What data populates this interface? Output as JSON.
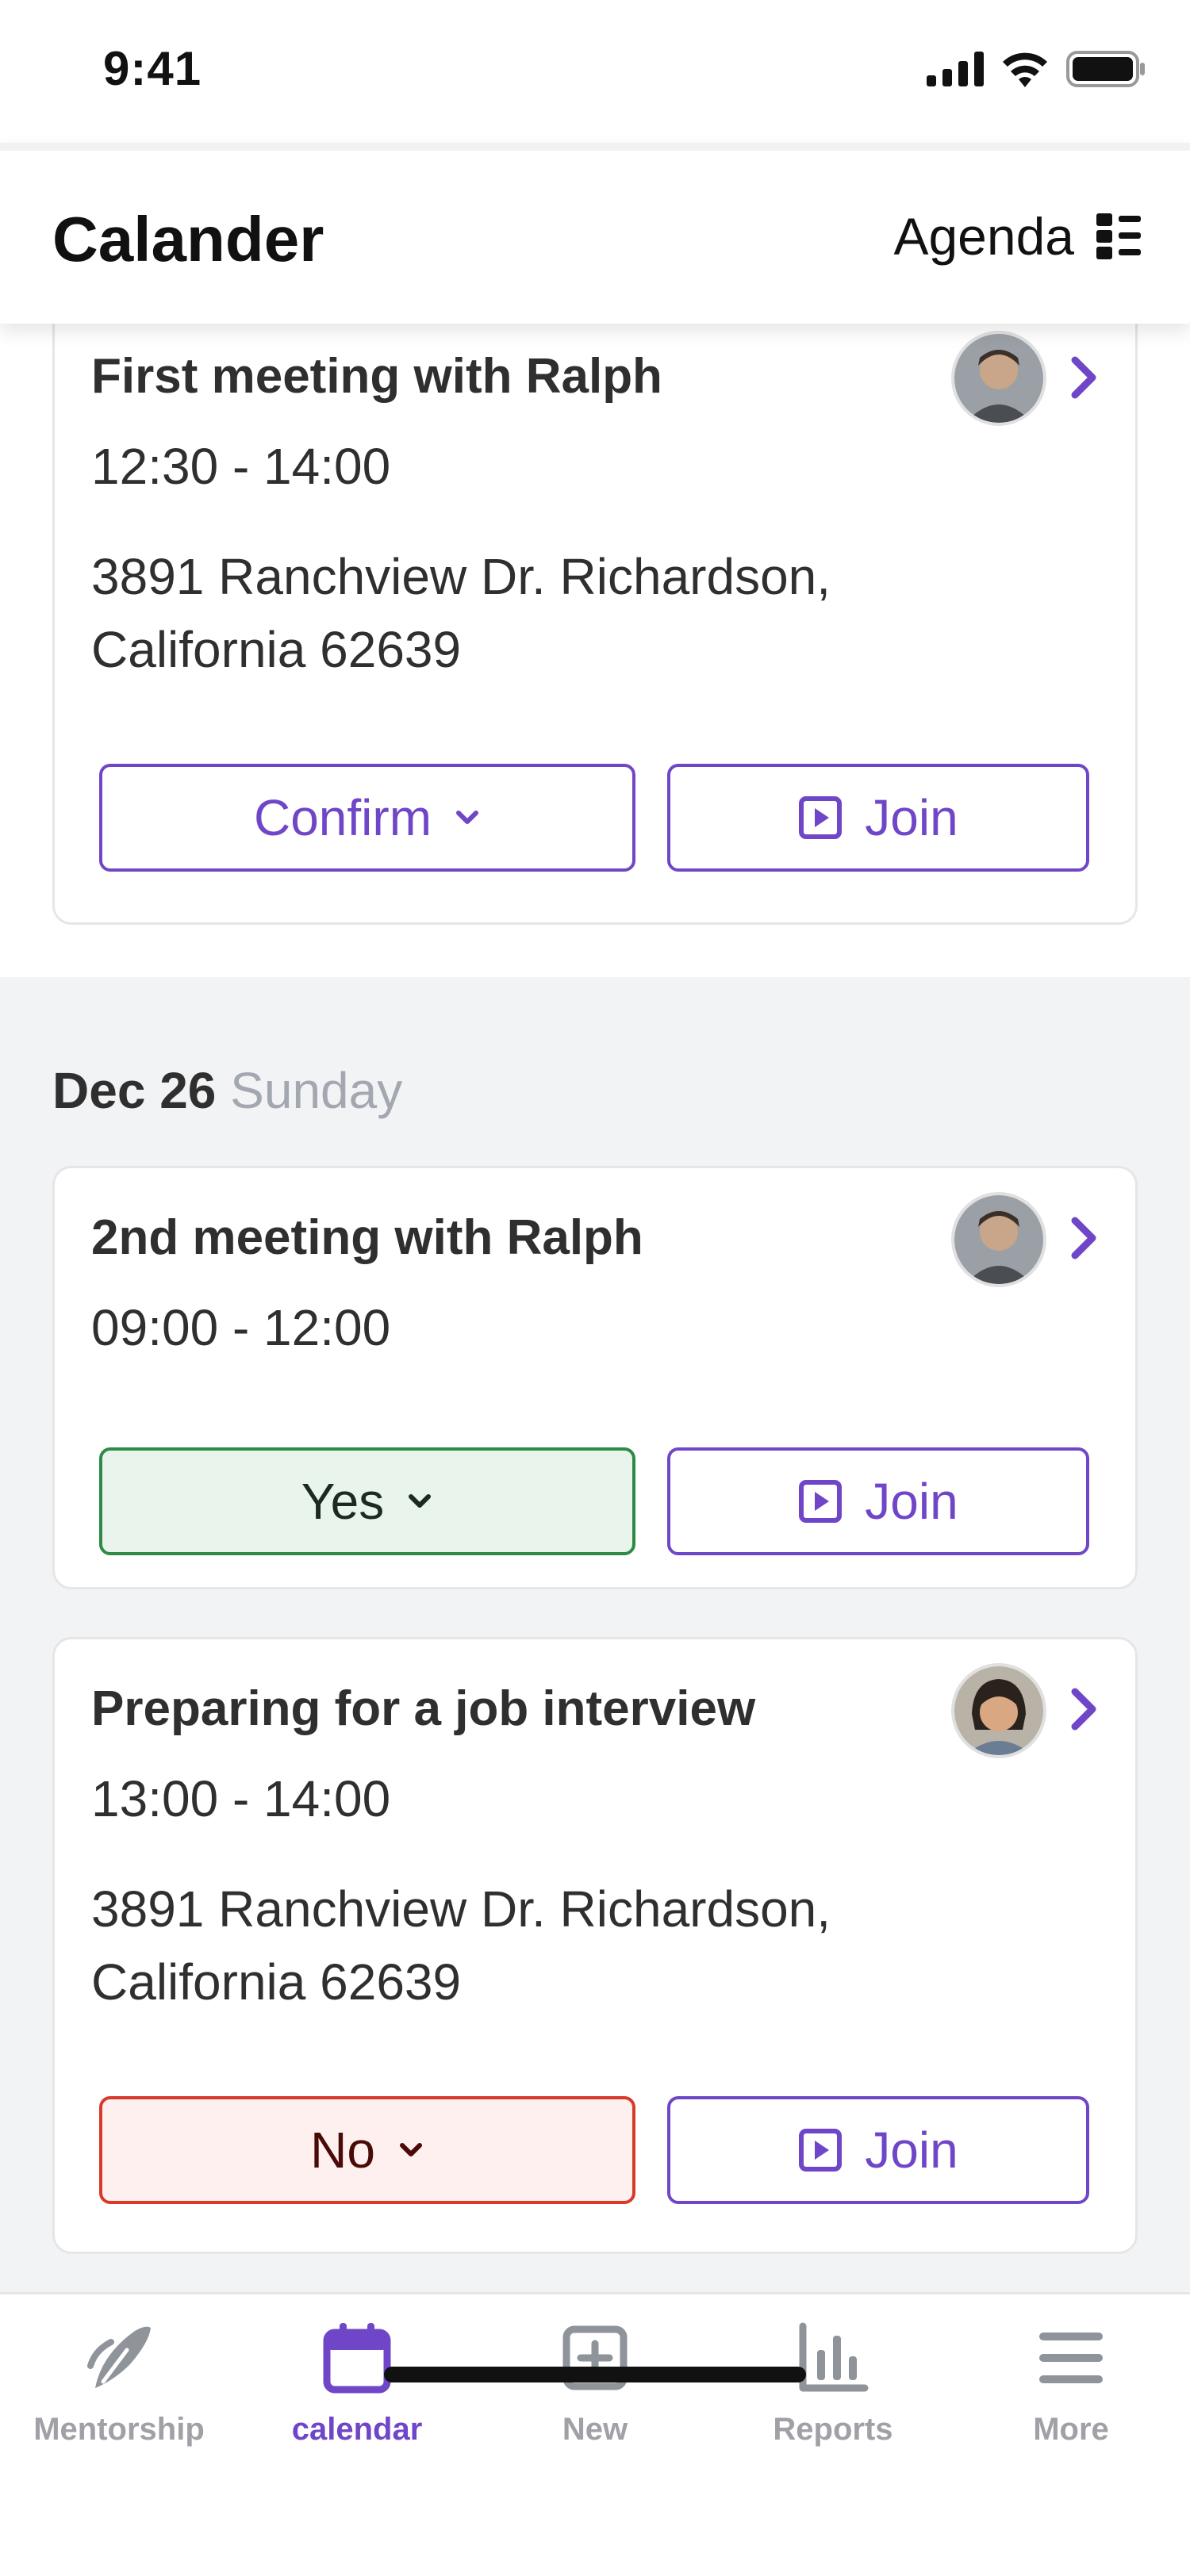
{
  "status_bar": {
    "time": "9:41"
  },
  "header": {
    "title": "Calander",
    "view_mode_label": "Agenda",
    "view_mode_icon": "agenda-grid-icon"
  },
  "events_top": [
    {
      "title": "First meeting with Ralph",
      "time": "12:30 - 14:00",
      "address_line1": "3891 Ranchview Dr. Richardson,",
      "address_line2": "California 62639",
      "response_label": "Confirm",
      "join_label": "Join"
    }
  ],
  "day_section": {
    "date": "Dec 26",
    "weekday": "Sunday"
  },
  "events_day": [
    {
      "title": "2nd meeting with Ralph",
      "time": "09:00 - 12:00",
      "response_label": "Yes",
      "join_label": "Join"
    },
    {
      "title": "Preparing for a job interview",
      "time": "13:00 - 14:00",
      "address_line1": "3891 Ranchview Dr. Richardson,",
      "address_line2": "California 62639",
      "response_label": "No",
      "join_label": "Join"
    }
  ],
  "bottom_nav": {
    "items": [
      {
        "label": "Mentorship",
        "icon": "mentorship-icon",
        "active": false
      },
      {
        "label": "calendar",
        "icon": "calendar-icon",
        "active": true
      },
      {
        "label": "New",
        "icon": "plus-square-icon",
        "active": false
      },
      {
        "label": "Reports",
        "icon": "bar-chart-icon",
        "active": false
      },
      {
        "label": "More",
        "icon": "menu-icon",
        "active": false
      }
    ]
  },
  "colors": {
    "accent": "#7046c8",
    "yes_border": "#2e8a45",
    "yes_bg": "#e9f5ec",
    "no_border": "#d83a2a",
    "no_bg": "#fdf0ef",
    "section_bg": "#f2f3f5"
  }
}
